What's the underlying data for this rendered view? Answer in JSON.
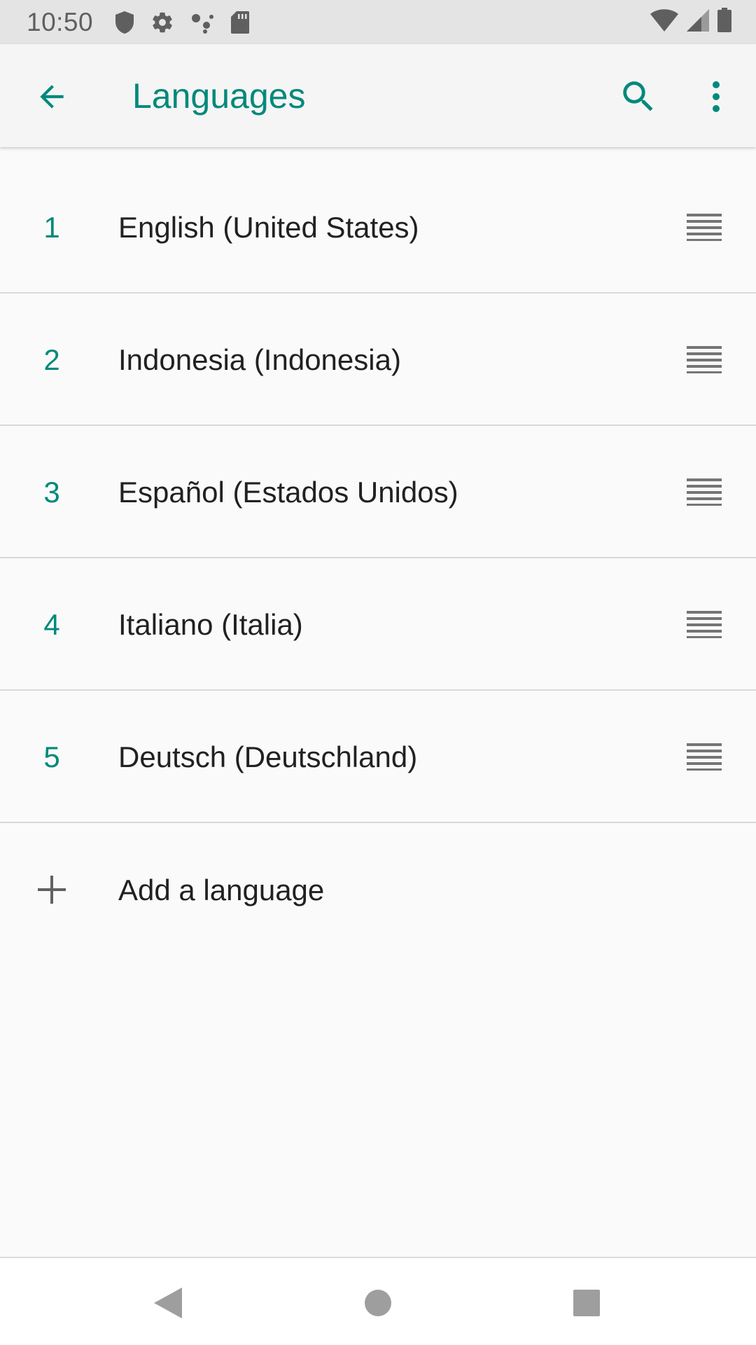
{
  "status_bar": {
    "time": "10:50",
    "icons_left": [
      "shield-icon",
      "gear-icon",
      "assistant-dots-icon",
      "sd-card-icon"
    ],
    "icons_right": [
      "wifi-icon",
      "cell-signal-icon",
      "battery-icon"
    ]
  },
  "app_bar": {
    "title": "Languages",
    "back_icon": "arrow-back-icon",
    "actions": [
      "search-icon",
      "more-vert-icon"
    ]
  },
  "languages": [
    {
      "rank": "1",
      "name": "English (United States)"
    },
    {
      "rank": "2",
      "name": "Indonesia (Indonesia)"
    },
    {
      "rank": "3",
      "name": "Español (Estados Unidos)"
    },
    {
      "rank": "4",
      "name": "Italiano (Italia)"
    },
    {
      "rank": "5",
      "name": "Deutsch (Deutschland)"
    }
  ],
  "add_language": {
    "label": "Add a language",
    "icon": "plus-icon"
  },
  "nav_bar": {
    "buttons": [
      "nav-back-icon",
      "nav-home-icon",
      "nav-recents-icon"
    ]
  },
  "colors": {
    "accent": "#00897b",
    "text_primary": "#212121",
    "icon_gray": "#5f5f5f",
    "background": "#fafafa"
  }
}
